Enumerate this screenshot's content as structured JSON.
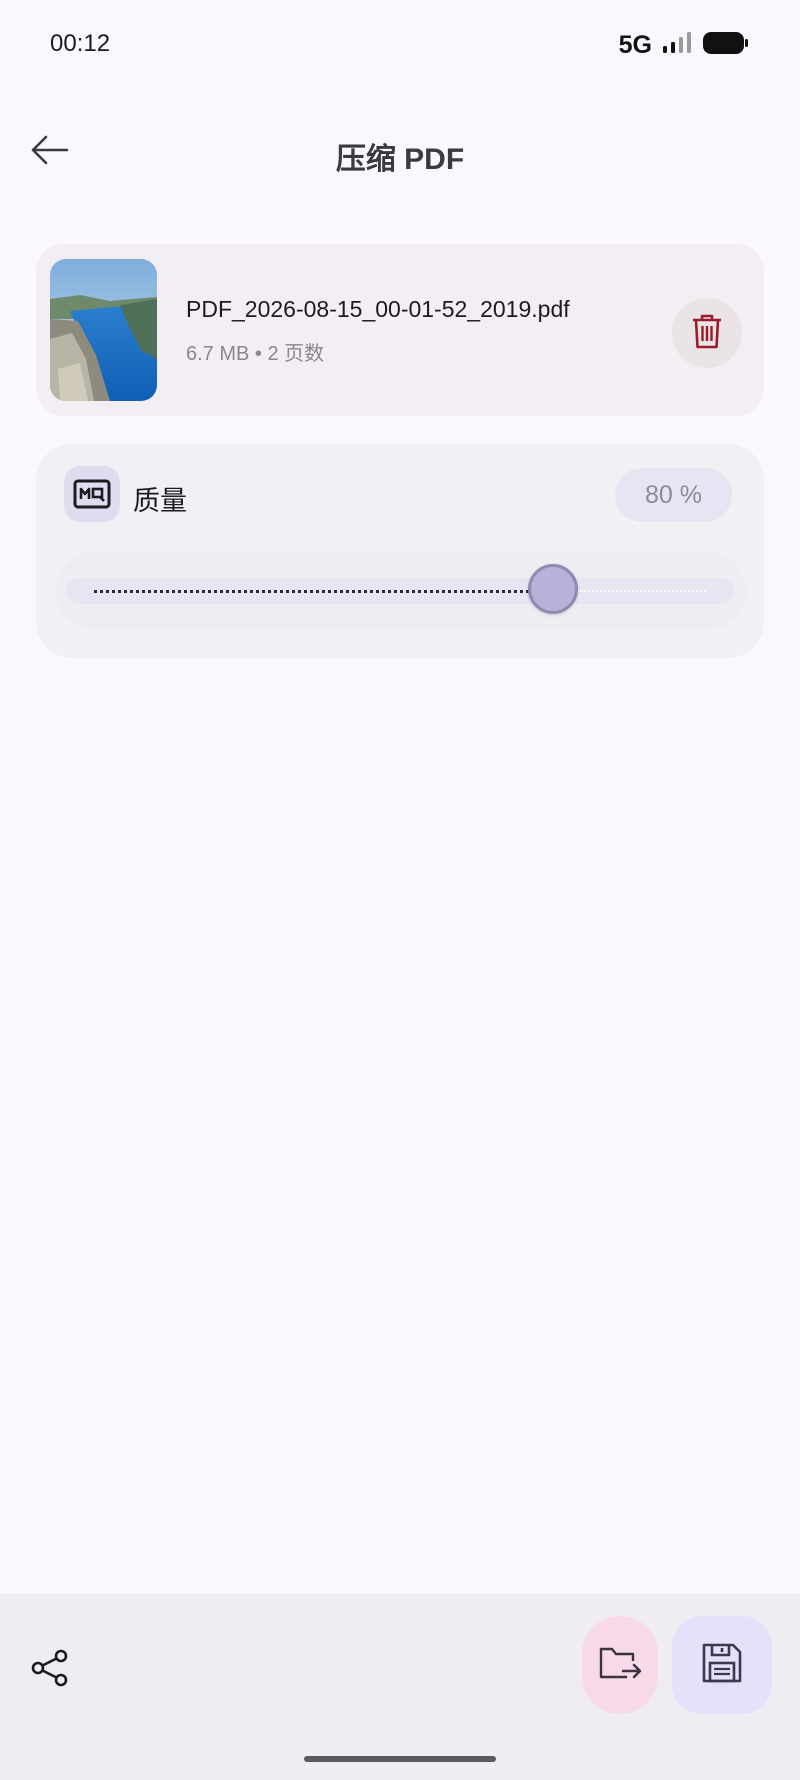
{
  "status_bar": {
    "time": "00:12",
    "network": "5G",
    "icons": [
      "signal-icon",
      "battery-icon"
    ]
  },
  "top_bar": {
    "title": "压缩 PDF",
    "back_icon": "arrow-left-icon"
  },
  "file_card": {
    "file_name": "PDF_2026-08-15_00-01-52_2019.pdf",
    "meta": "6.7 MB • 2 页数",
    "thumbnail_icon": "landscape-thumbnail",
    "delete_icon": "trash-icon"
  },
  "quality": {
    "label": "质量",
    "value_text": "80 %",
    "value": 0.8,
    "icon": "quality-mq-icon"
  },
  "bottom_bar": {
    "share_icon": "share-icon",
    "move_icon": "folder-move-icon",
    "save_icon": "floppy-save-icon"
  },
  "colors": {
    "background": "#faf8fc",
    "accent_delete": "#9b1b2a",
    "move_button": "#f8d9e7",
    "save_button": "#e4e1fa",
    "slider_thumb": "#b6b2d8"
  }
}
